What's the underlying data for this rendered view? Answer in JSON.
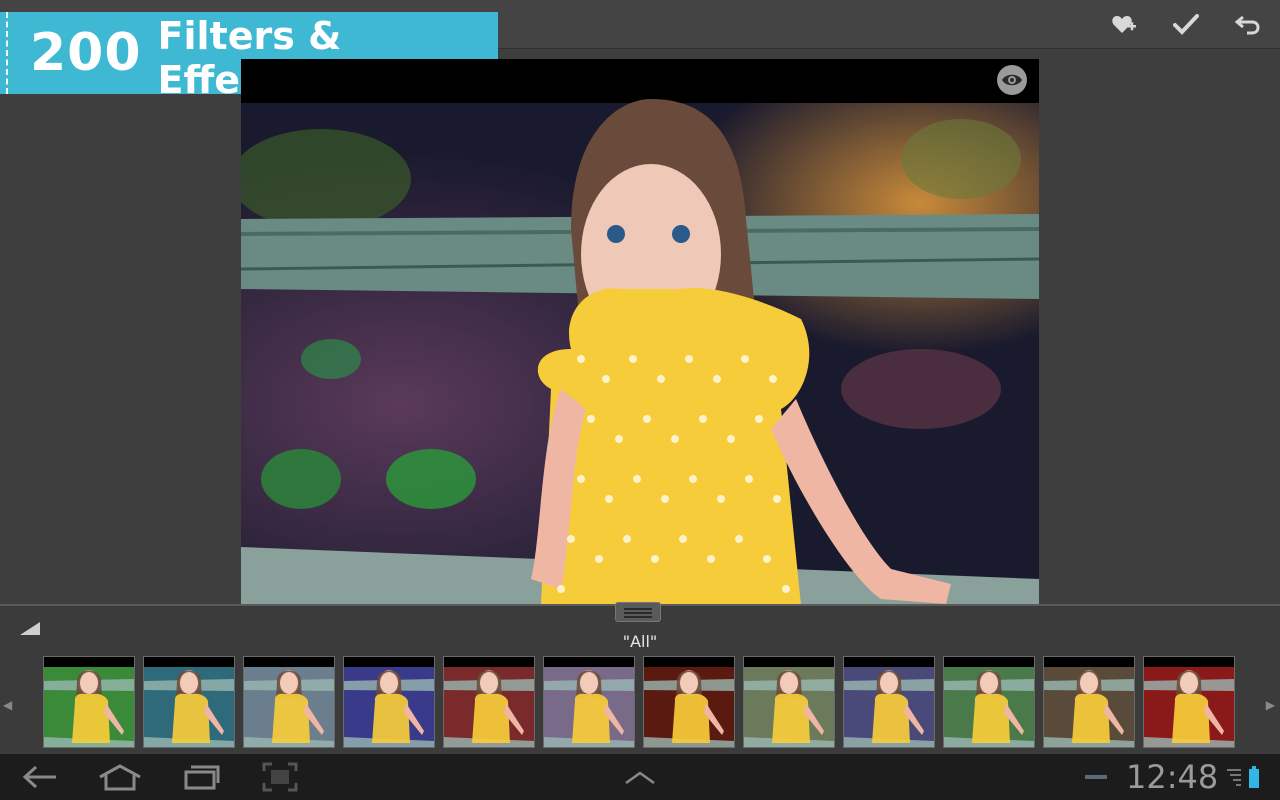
{
  "banner": {
    "count": "200",
    "text": "Filters & Effects"
  },
  "toolbar": {
    "actions": [
      {
        "icon": "heart-plus-icon"
      },
      {
        "icon": "check-icon"
      },
      {
        "icon": "undo-icon"
      }
    ]
  },
  "preview": {
    "eye_icon": "eye-icon"
  },
  "filter_strip": {
    "category_label": "\"All\"",
    "thumbnails": [
      {
        "tint": "#3a8a3a"
      },
      {
        "tint": "#2e6a7a"
      },
      {
        "tint": "#6a7e8e"
      },
      {
        "tint": "#3a3a8a"
      },
      {
        "tint": "#7a2a2a"
      },
      {
        "tint": "#7a6a8a"
      },
      {
        "tint": "#5a1a10"
      },
      {
        "tint": "#6a7a5a"
      },
      {
        "tint": "#4a4a7a"
      },
      {
        "tint": "#4a7a4a"
      },
      {
        "tint": "#5a4a3a"
      },
      {
        "tint": "#8a1a1a"
      }
    ]
  },
  "status_bar": {
    "time": "12:48"
  },
  "colors": {
    "banner": "#3fb8d3",
    "accent_battery": "#33b5e5"
  }
}
